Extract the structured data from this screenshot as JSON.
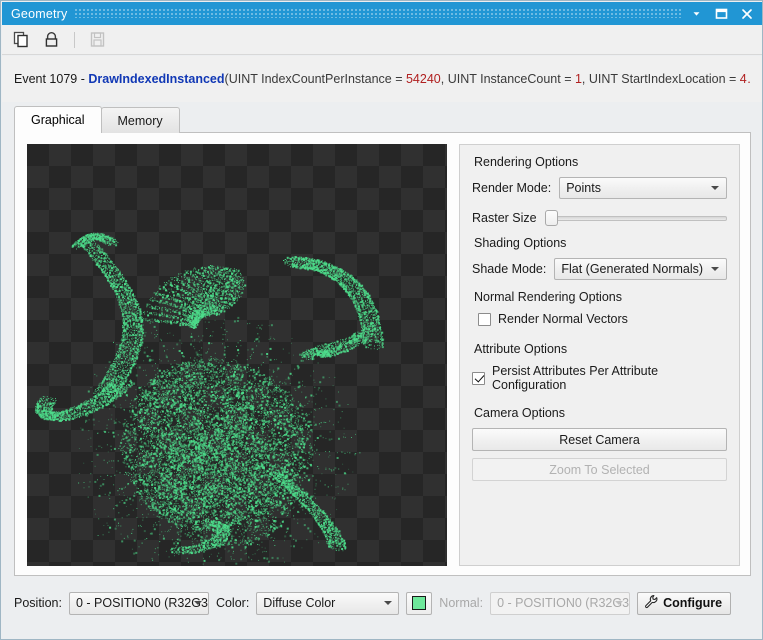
{
  "window": {
    "title": "Geometry",
    "accent_color": "#2196d4",
    "controls": [
      {
        "name": "menu-chevron",
        "icon": "chevron-down-icon"
      },
      {
        "name": "maximize",
        "icon": "maximize-icon"
      },
      {
        "name": "close",
        "icon": "close-icon"
      }
    ]
  },
  "toolbar": {
    "buttons": [
      {
        "name": "copy",
        "icon": "copy-icon",
        "enabled": true
      },
      {
        "name": "lock",
        "icon": "lock-icon",
        "enabled": true
      },
      {
        "name": "save",
        "icon": "save-icon",
        "enabled": false
      }
    ]
  },
  "event": {
    "prefix": "Event 1079 - ",
    "function": "DrawIndexedInstanced",
    "open_paren": "(",
    "args": [
      {
        "text": "UINT IndexCountPerInstance = ",
        "value": "54240",
        "sep": ", "
      },
      {
        "text": "UINT InstanceCount = ",
        "value": "1",
        "sep": ", "
      },
      {
        "text": "UINT StartIndexLocation = ",
        "value": "4",
        "sep": "…"
      }
    ],
    "full_text": "Event 1079 -  DrawIndexedInstanced(UINT IndexCountPerInstance = 54240, UINT InstanceCount = 1, UINT StartIndexLocation = 4…"
  },
  "tabs": [
    {
      "label": "Graphical",
      "active": true
    },
    {
      "label": "Memory",
      "active": false
    }
  ],
  "viewport": {
    "background_color": "#262626",
    "checker_color": "#303030",
    "point_color": "#4ddd8b",
    "checker_size_px": 22
  },
  "options": {
    "rendering_options_label": "Rendering Options",
    "render_mode_label": "Render Mode:",
    "render_mode_value": "Points",
    "raster_size_label": "Raster Size",
    "raster_size_value": 0,
    "shading_options_label": "Shading Options",
    "shade_mode_label": "Shade Mode:",
    "shade_mode_value": "Flat (Generated Normals)",
    "normal_rendering_options_label": "Normal Rendering Options",
    "render_normal_vectors_label": "Render Normal Vectors",
    "render_normal_vectors_checked": false,
    "attribute_options_label": "Attribute Options",
    "persist_attributes_label": "Persist Attributes Per Attribute Configuration",
    "persist_attributes_checked": true,
    "camera_options_label": "Camera Options",
    "reset_camera_label": "Reset Camera",
    "reset_camera_enabled": true,
    "zoom_to_selected_label": "Zoom To Selected",
    "zoom_to_selected_enabled": false
  },
  "bottom_bar": {
    "position_label": "Position:",
    "position_value": "0 - POSITION0 (R32G3",
    "color_label": "Color:",
    "color_value": "Diffuse Color",
    "color_swatch": "#6ee89b",
    "normal_label": "Normal:",
    "normal_value": "0 - POSITION0 (R32G3",
    "normal_enabled": false,
    "configure_label": "Configure"
  }
}
